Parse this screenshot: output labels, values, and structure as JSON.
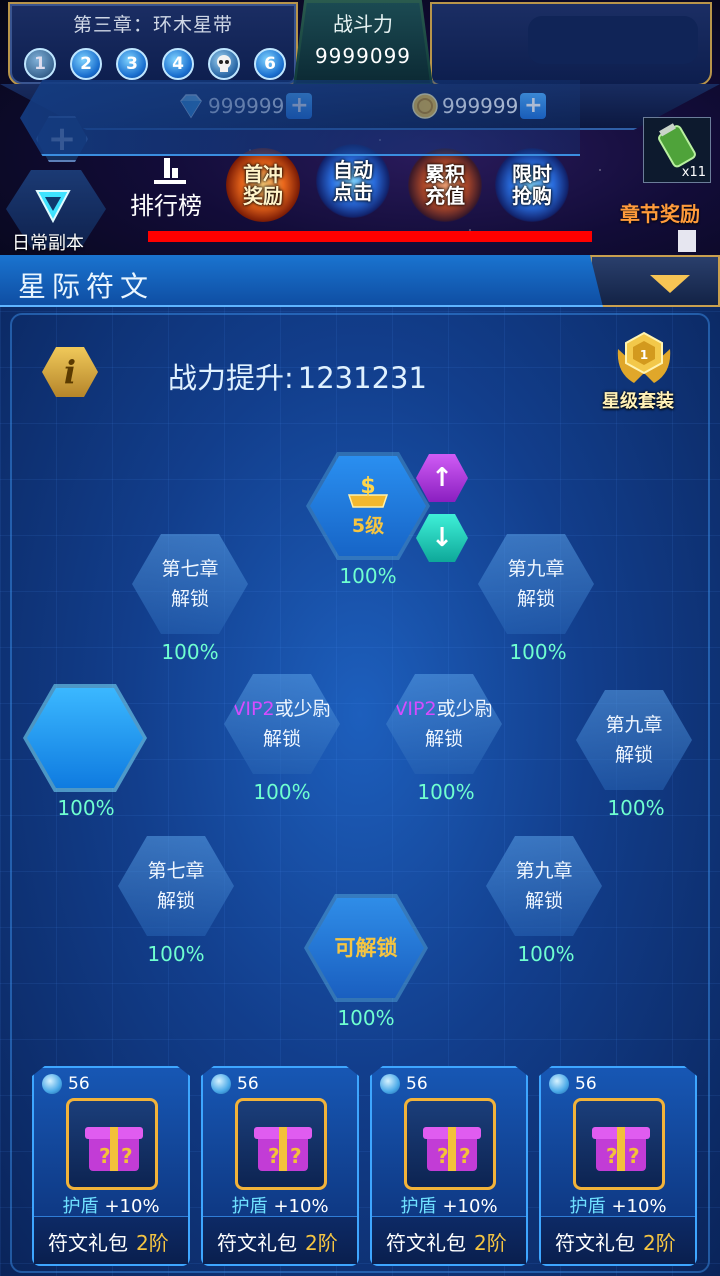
{
  "hud": {
    "chapter_title": "第三章：环木星带",
    "stages": [
      "1",
      "2",
      "3",
      "4",
      "skull",
      "6"
    ],
    "power_label": "战斗力",
    "power_value": "9999099",
    "diamonds": "999999",
    "gold": "999999",
    "daily_dungeon": "日常副本",
    "ranking": "排行榜",
    "buttons": [
      {
        "line1": "首冲",
        "line2": "奖励"
      },
      {
        "line1": "自动",
        "line2": "点击"
      },
      {
        "line1": "累积",
        "line2": "充值"
      },
      {
        "line1": "限时",
        "line2": "抢购"
      }
    ],
    "item_qty": "x11",
    "chapter_reward": "章节奖励",
    "colors": {
      "accent_gold": "#b8954a",
      "alert_red": "#ff0000"
    }
  },
  "panel": {
    "title": "星际符文",
    "power_boost_label": "战力提升:",
    "power_boost_value": "1231231",
    "medal_num": "1",
    "suit_label": "星级套装"
  },
  "nodes": {
    "center_top": {
      "level": "5级",
      "pct": "100%"
    },
    "left_top": {
      "line1": "第七章",
      "line2": "解锁",
      "pct": "100%"
    },
    "right_top": {
      "line1": "第九章",
      "line2": "解锁",
      "pct": "100%"
    },
    "far_left": {
      "pct": "100%"
    },
    "mid_left": {
      "vip": "VIP2",
      "rest": "或少尉",
      "line2": "解锁",
      "pct": "100%"
    },
    "mid_right": {
      "vip": "VIP2",
      "rest": "或少尉",
      "line2": "解锁",
      "pct": "100%"
    },
    "far_right": {
      "line1": "第九章",
      "line2": "解锁",
      "pct": "100%"
    },
    "left_bottom": {
      "line1": "第七章",
      "line2": "解锁",
      "pct": "100%"
    },
    "right_bottom": {
      "line1": "第九章",
      "line2": "解锁",
      "pct": "100%"
    },
    "center_bottom": {
      "label": "可解锁",
      "pct": "100%"
    }
  },
  "cards": [
    {
      "count": "56",
      "stat": "护盾",
      "value": "+10%",
      "name": "符文礼包",
      "tier": "2阶"
    },
    {
      "count": "56",
      "stat": "护盾",
      "value": "+10%",
      "name": "符文礼包",
      "tier": "2阶"
    },
    {
      "count": "56",
      "stat": "护盾",
      "value": "+10%",
      "name": "符文礼包",
      "tier": "2阶"
    },
    {
      "count": "56",
      "stat": "护盾",
      "value": "+10%",
      "name": "符文礼包",
      "tier": "2阶"
    }
  ]
}
